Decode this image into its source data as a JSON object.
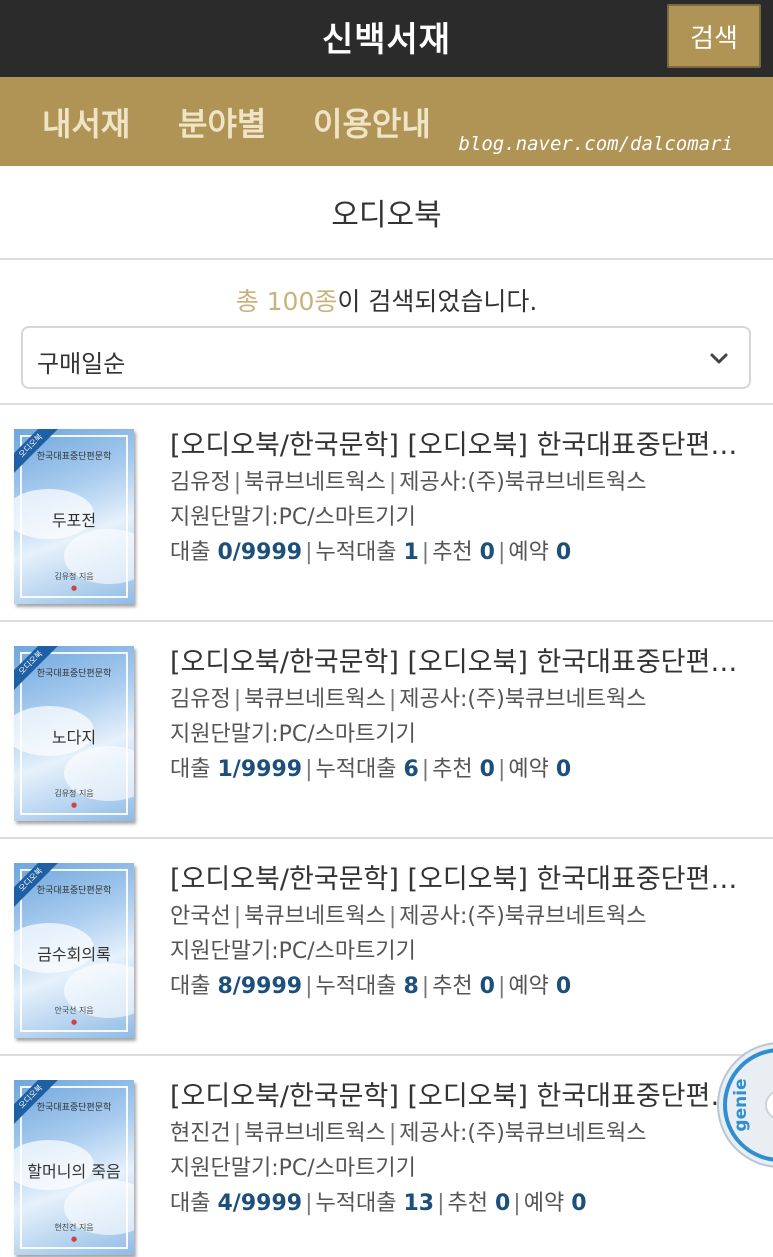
{
  "header": {
    "title": "신백서재",
    "search_label": "검색"
  },
  "nav": {
    "items": [
      "내서재",
      "분야별",
      "이용안내"
    ],
    "watermark": "blog.naver.com/dalcomari"
  },
  "section": {
    "title": "오디오북"
  },
  "result": {
    "prefix_highlight": "총 100종",
    "suffix": "이 검색되었습니다."
  },
  "sort": {
    "selected": "구매일순"
  },
  "labels": {
    "meta_provider_prefix": "제공사:",
    "device_prefix": "지원단말기:",
    "loan": "대출",
    "cumulative": "누적대출",
    "recommend": "추천",
    "reserve": "예약"
  },
  "books": [
    {
      "title": "[오디오북/한국문학] [오디오북] 한국대표중단편문학",
      "author": "김유정",
      "publisher": "북큐브네트웍스",
      "provider": "(주)북큐브네트웍스",
      "device": "PC/스마트기기",
      "loan": "0/9999",
      "cumulative": "1",
      "recommend": "0",
      "reserve": "0",
      "cover_series": "한국대표중단편문학",
      "cover_title": "두포전",
      "cover_author": "김유정 지음",
      "cover_ribbon": "오디오북"
    },
    {
      "title": "[오디오북/한국문학] [오디오북] 한국대표중단편문학",
      "author": "김유정",
      "publisher": "북큐브네트웍스",
      "provider": "(주)북큐브네트웍스",
      "device": "PC/스마트기기",
      "loan": "1/9999",
      "cumulative": "6",
      "recommend": "0",
      "reserve": "0",
      "cover_series": "한국대표중단편문학",
      "cover_title": "노다지",
      "cover_author": "김유정 지음",
      "cover_ribbon": "오디오북"
    },
    {
      "title": "[오디오북/한국문학] [오디오북] 한국대표중단편문학",
      "author": "안국선",
      "publisher": "북큐브네트웍스",
      "provider": "(주)북큐브네트웍스",
      "device": "PC/스마트기기",
      "loan": "8/9999",
      "cumulative": "8",
      "recommend": "0",
      "reserve": "0",
      "cover_series": "한국대표중단편문학",
      "cover_title": "금수회의록",
      "cover_author": "안국선 지음",
      "cover_ribbon": "오디오북"
    },
    {
      "title": "[오디오북/한국문학] [오디오북] 한국대표중단편문학",
      "author": "현진건",
      "publisher": "북큐브네트웍스",
      "provider": "(주)북큐브네트웍스",
      "device": "PC/스마트기기",
      "loan": "4/9999",
      "cumulative": "13",
      "recommend": "0",
      "reserve": "0",
      "cover_series": "한국대표중단편문학",
      "cover_title": "할머니의 죽음",
      "cover_author": "현진건 지음",
      "cover_ribbon": "오디오북"
    }
  ],
  "floating": {
    "label": "genie"
  }
}
